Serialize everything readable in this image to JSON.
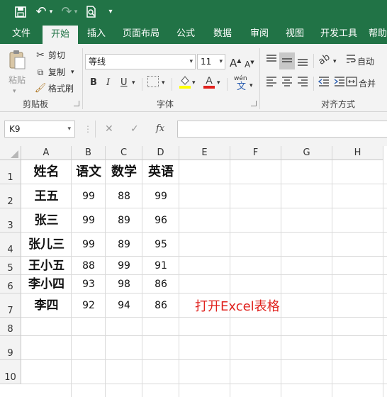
{
  "quick_access": {
    "undo_label": "↶",
    "redo_label": "↷",
    "customize_label": "▾"
  },
  "tabs": [
    "文件",
    "开始",
    "插入",
    "页面布局",
    "公式",
    "数据",
    "审阅",
    "视图",
    "开发工具",
    "帮助"
  ],
  "ribbon": {
    "clipboard": {
      "paste": "粘贴",
      "cut": "剪切",
      "copy": "复制",
      "format_painter": "格式刷",
      "group_label": "剪贴板"
    },
    "font": {
      "font_name": "等线",
      "font_size": "11",
      "grow": "A",
      "shrink": "A",
      "bold": "B",
      "italic": "I",
      "underline": "U",
      "phonetic": "wén",
      "group_label": "字体"
    },
    "alignment": {
      "wrap": "自动",
      "merge": "合并",
      "group_label": "对齐方式"
    }
  },
  "formula_bar": {
    "name_box": "K9",
    "fx": "fx",
    "formula": ""
  },
  "sheet": {
    "columns": [
      "A",
      "B",
      "C",
      "D",
      "E",
      "F",
      "G",
      "H"
    ],
    "rows": [
      "1",
      "2",
      "3",
      "4",
      "5",
      "6",
      "7",
      "8",
      "9",
      "10"
    ],
    "headers": [
      "姓名",
      "语文",
      "数学",
      "英语"
    ],
    "data": [
      [
        "王五",
        "99",
        "88",
        "99"
      ],
      [
        "张三",
        "99",
        "89",
        "96"
      ],
      [
        "张儿三",
        "99",
        "89",
        "95"
      ],
      [
        "王小五",
        "88",
        "99",
        "91"
      ],
      [
        "李小四",
        "93",
        "98",
        "86"
      ],
      [
        "李四",
        "92",
        "94",
        "86"
      ]
    ],
    "note": "打开Excel表格"
  },
  "colors": {
    "accent": "#217346",
    "note": "#e0211d"
  }
}
